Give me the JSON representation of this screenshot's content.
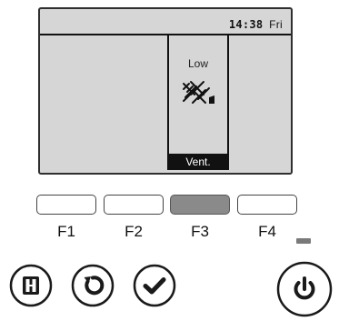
{
  "screen": {
    "time": "14:38",
    "day": "Fri",
    "panel": {
      "level": "Low",
      "label": "Vent.",
      "icon": "ventilation-fan-icon"
    }
  },
  "function_keys": [
    {
      "label": "F1",
      "active": false
    },
    {
      "label": "F2",
      "active": false
    },
    {
      "label": "F3",
      "active": true
    },
    {
      "label": "F4",
      "active": false
    }
  ],
  "buttons": {
    "menu": "menu-icon",
    "return": "return-icon",
    "select": "check-icon",
    "power": "power-icon"
  },
  "colors": {
    "screen_bg": "#d6d6d6",
    "active_key": "#8a8a8a",
    "ink": "#111111"
  }
}
